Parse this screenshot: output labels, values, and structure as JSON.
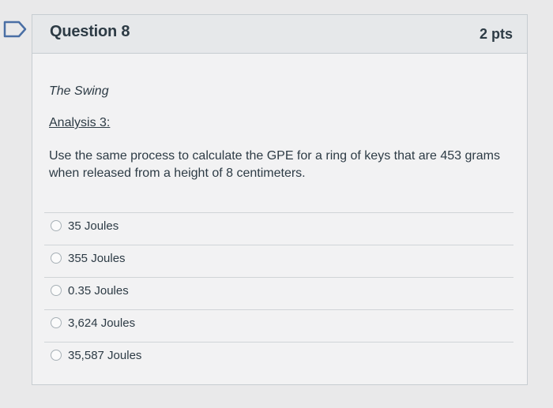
{
  "question": {
    "title": "Question 8",
    "points": "2 pts",
    "subtitle": "The Swing",
    "analysis_label": "Analysis 3:",
    "prompt": "Use the same process to calculate the GPE for a ring of keys that are 453 grams when released from a height of 8 centimeters."
  },
  "answers": [
    {
      "label": "35 Joules"
    },
    {
      "label": "355 Joules"
    },
    {
      "label": "0.35 Joules"
    },
    {
      "label": "3,624 Joules"
    },
    {
      "label": "35,587 Joules"
    }
  ],
  "colors": {
    "text": "#2d3b45",
    "flag": "#4a6fa5",
    "border": "#c7cdd1"
  },
  "icons": {
    "flag": "bookmark-flag-icon"
  }
}
